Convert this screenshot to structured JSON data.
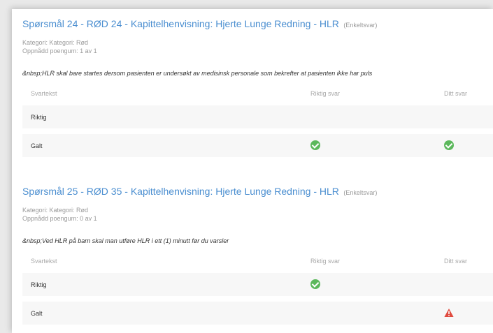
{
  "questions": [
    {
      "title": "Spørsmål 24 - RØD 24 - Kapittelhenvisning: Hjerte Lunge Redning - HLR",
      "type": "(Enkeltsvar)",
      "category": "Kategori: Kategori: Rød",
      "score": "Oppnådd poengum: 1 av 1",
      "text": "&nbsp;HLR skal bare startes dersom pasienten er undersøkt av medisinsk personale som bekrefter at pasienten ikke har puls",
      "headers": {
        "answer": "Svartekst",
        "correct": "Riktig svar",
        "yours": "Ditt svar"
      },
      "rows": [
        {
          "label": "Riktig",
          "correct_icon": "",
          "your_icon": ""
        },
        {
          "label": "Galt",
          "correct_icon": "check-circle-icon",
          "your_icon": "check-circle-icon"
        }
      ]
    },
    {
      "title": "Spørsmål 25 - RØD 35 - Kapittelhenvisning: Hjerte Lunge Redning - HLR",
      "type": "(Enkeltsvar)",
      "category": "Kategori: Kategori: Rød",
      "score": "Oppnådd poengum: 0 av 1",
      "text": "&nbsp;Ved HLR på barn skal man utføre HLR i ett (1) minutt før du varsler",
      "headers": {
        "answer": "Svartekst",
        "correct": "Riktig svar",
        "yours": "Ditt svar"
      },
      "rows": [
        {
          "label": "Riktig",
          "correct_icon": "check-circle-icon",
          "your_icon": ""
        },
        {
          "label": "Galt",
          "correct_icon": "",
          "your_icon": "warning-triangle-icon"
        }
      ]
    }
  ],
  "colors": {
    "title": "#4a8ed0",
    "ok": "#5cb85c",
    "warn": "#e04b3f"
  }
}
